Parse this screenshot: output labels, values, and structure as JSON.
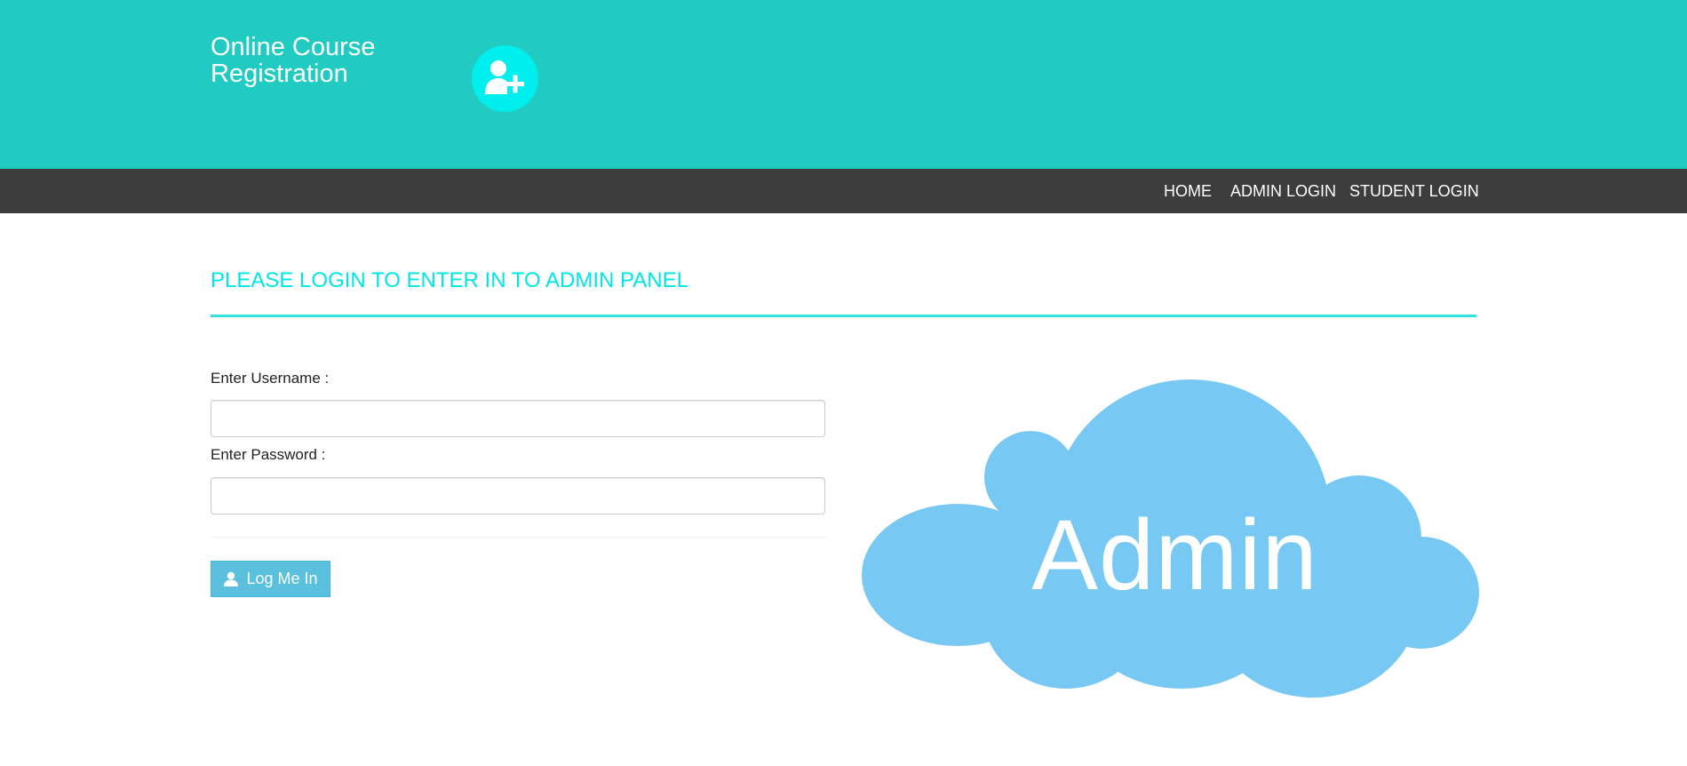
{
  "header": {
    "brand_title": "Online Course Registration",
    "brand_icon": "user-plus-icon",
    "background_color": "#22cbc1",
    "icon_circle_color": "#00eeee"
  },
  "nav": {
    "background_color": "#3d3d3d",
    "items": [
      {
        "label": "HOME"
      },
      {
        "label": "ADMIN LOGIN"
      },
      {
        "label": "STUDENT LOGIN"
      }
    ]
  },
  "main": {
    "panel_title": "PLEASE LOGIN TO ENTER IN TO ADMIN PANEL",
    "accent_color": "#00e6e6",
    "form": {
      "username_label": "Enter Username :",
      "username_value": "",
      "password_label": "Enter Password :",
      "password_value": "",
      "submit_label": "Log Me In",
      "submit_icon": "user-icon",
      "submit_color": "#5bc0de"
    },
    "illustration": {
      "text": "Admin",
      "cloud_color": "#78c8f4"
    }
  }
}
